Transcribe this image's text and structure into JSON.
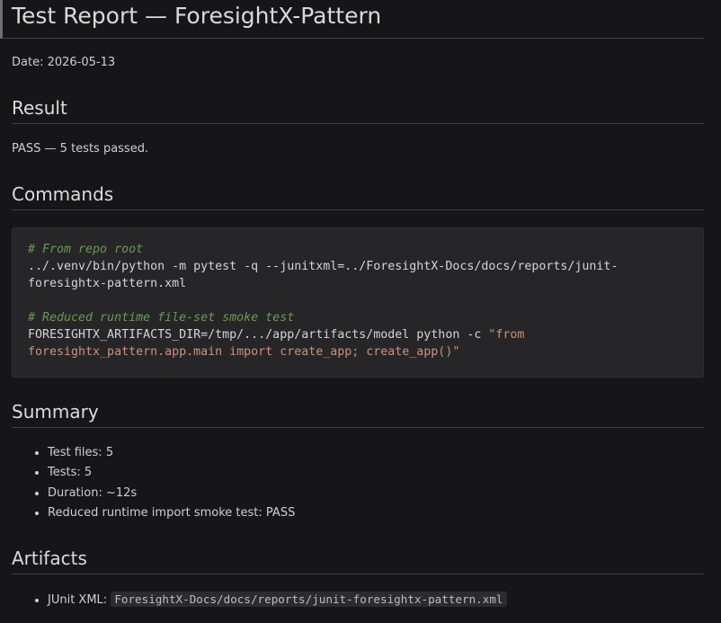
{
  "title": "Test Report — ForesightX-Pattern",
  "date_line": "Date: 2026-05-13",
  "sections": {
    "result": {
      "heading": "Result",
      "text": "PASS — 5 tests passed."
    },
    "commands": {
      "heading": "Commands",
      "code": {
        "comment1": "# From repo root",
        "cmd1_line1": "../.venv/bin/python -m pytest -q --junitxml=../ForesightX-Docs/docs/reports/junit-",
        "cmd1_line2": "foresightx-pattern.xml",
        "comment2": "# Reduced runtime file-set smoke test",
        "cmd2_prefix": "FORESIGHTX_ARTIFACTS_DIR=/tmp/.../app/artifacts/model python -c ",
        "cmd2_str_line1": "\"from",
        "cmd2_str_line2": "foresightx_pattern.app.main import create_app; create_app()\""
      }
    },
    "summary": {
      "heading": "Summary",
      "items": [
        "Test files: 5",
        "Tests: 5",
        "Duration: ~12s",
        "Reduced runtime import smoke test: PASS"
      ]
    },
    "artifacts": {
      "heading": "Artifacts",
      "items": [
        {
          "label": "JUnit XML: ",
          "path": "ForesightX-Docs/docs/reports/junit-foresightx-pattern.xml"
        }
      ]
    }
  }
}
